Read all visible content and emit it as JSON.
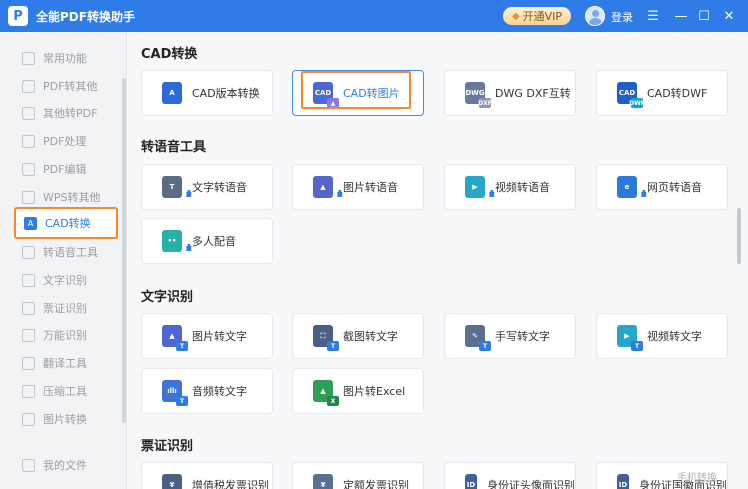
{
  "app": {
    "logo_letter": "P",
    "title": "全能PDF转换助手"
  },
  "header": {
    "vip_label": "开通VIP",
    "login_label": "登录"
  },
  "sidebar": {
    "items": [
      {
        "label": "常用功能"
      },
      {
        "label": "PDF转其他"
      },
      {
        "label": "其他转PDF"
      },
      {
        "label": "PDF处理"
      },
      {
        "label": "PDF编辑"
      },
      {
        "label": "WPS转其他"
      },
      {
        "label": "CAD转换",
        "active": true
      },
      {
        "label": "转语音工具"
      },
      {
        "label": "文字识别"
      },
      {
        "label": "票证识别"
      },
      {
        "label": "万能识别"
      },
      {
        "label": "翻译工具"
      },
      {
        "label": "压缩工具"
      },
      {
        "label": "图片转换"
      },
      {
        "label": "我的文件"
      }
    ]
  },
  "sections": {
    "cad": {
      "title": "CAD转换",
      "cards": [
        {
          "label": "CAD版本转换",
          "icon": "cad-version-icon"
        },
        {
          "label": "CAD转图片",
          "icon": "cad-to-image-icon",
          "selected": true
        },
        {
          "label": "DWG DXF互转",
          "icon": "dwg-dxf-icon"
        },
        {
          "label": "CAD转DWF",
          "icon": "cad-to-dwf-icon"
        }
      ]
    },
    "speech": {
      "title": "转语音工具",
      "cards": [
        {
          "label": "文字转语音",
          "icon": "text-to-speech-icon"
        },
        {
          "label": "图片转语音",
          "icon": "image-to-speech-icon"
        },
        {
          "label": "视频转语音",
          "icon": "video-to-speech-icon"
        },
        {
          "label": "网页转语音",
          "icon": "webpage-to-speech-icon"
        },
        {
          "label": "多人配音",
          "icon": "multi-dubbing-icon"
        }
      ]
    },
    "ocr": {
      "title": "文字识别",
      "cards": [
        {
          "label": "图片转文字",
          "icon": "image-to-text-icon"
        },
        {
          "label": "截图转文字",
          "icon": "screenshot-to-text-icon"
        },
        {
          "label": "手写转文字",
          "icon": "handwriting-to-text-icon"
        },
        {
          "label": "视频转文字",
          "icon": "video-to-text-icon"
        },
        {
          "label": "音频转文字",
          "icon": "audio-to-text-icon"
        },
        {
          "label": "图片转Excel",
          "icon": "image-to-excel-icon"
        }
      ]
    },
    "ticket": {
      "title": "票证识别",
      "cards": [
        {
          "label": "增值税发票识别"
        },
        {
          "label": "定额发票识别"
        },
        {
          "label": "身份证头像面识别"
        },
        {
          "label": "身份证国徽面识别"
        }
      ]
    }
  },
  "watermark": "手机转换",
  "colors": {
    "brand": "#2f7ce8",
    "highlight": "#f5892c"
  }
}
